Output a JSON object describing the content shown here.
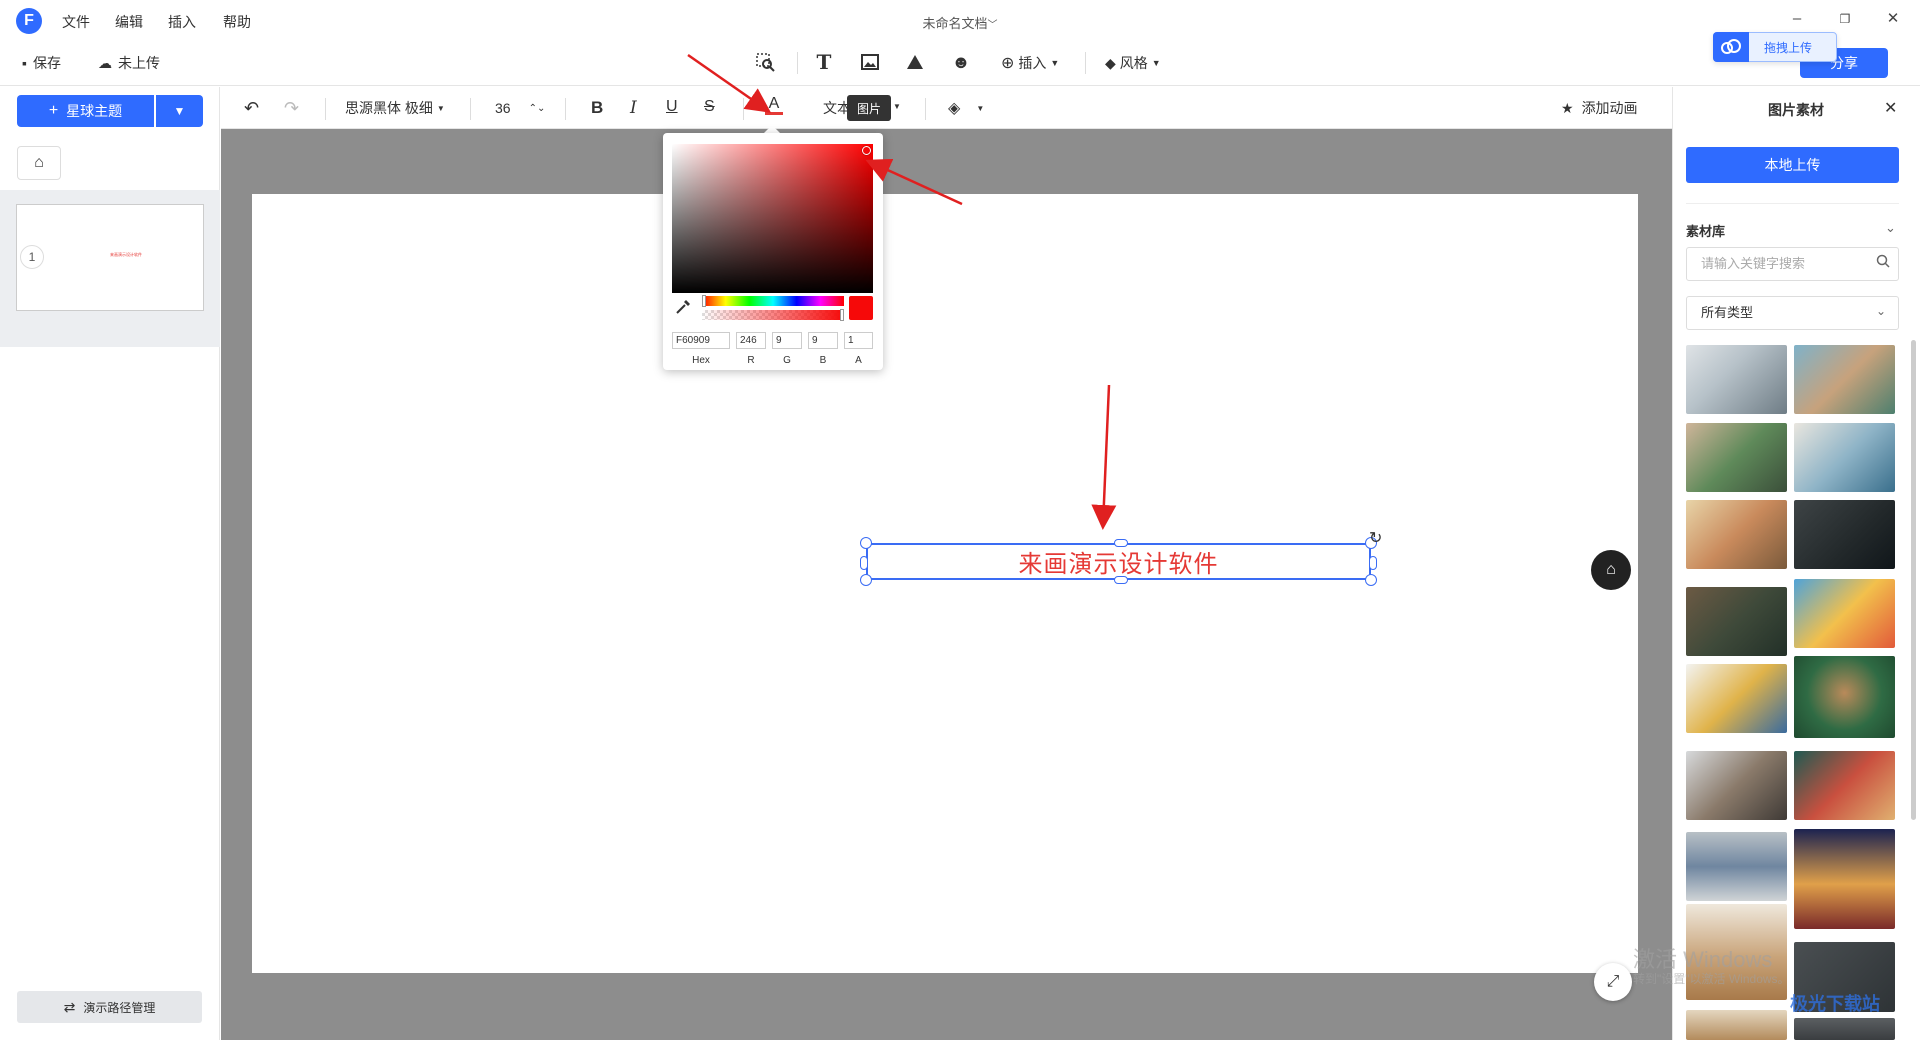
{
  "titlebar": {
    "menus": [
      "文件",
      "编辑",
      "插入",
      "帮助"
    ],
    "doc_title": "未命名文档",
    "doc_title_caret": "﹀",
    "win_controls": [
      "–",
      "❐",
      "✕"
    ]
  },
  "toolbar": {
    "save_label": "保存",
    "upload_state": "未上传",
    "insert_label": "插入",
    "style_label": "风格",
    "share_label": "分享",
    "drag_upload_tip": "拖拽上传"
  },
  "left_panel": {
    "theme_label": "星球主题",
    "slide_number": "1",
    "thumb_text": "来画演示设计软件",
    "path_manage_label": "演示路径管理"
  },
  "format_bar": {
    "font": "思源黑体 极细",
    "font_size": "36",
    "text_label": "文本",
    "tooltip": "图片",
    "animation_label": "添加动画"
  },
  "canvas": {
    "text_content": "来画演示设计软件"
  },
  "color_picker": {
    "hex": "F60909",
    "r": "246",
    "g": "9",
    "b": "9",
    "a": "1",
    "labels": [
      "Hex",
      "R",
      "G",
      "B",
      "A"
    ],
    "current_color": "#f60909"
  },
  "right_panel": {
    "title": "图片素材",
    "local_upload": "本地上传",
    "library_title": "素材库",
    "search_placeholder": "请输入关键字搜索",
    "type_select": "所有类型"
  },
  "watermarks": {
    "windows": "激活 Windows",
    "windows_sub": "转到\"设置\"以激活 Windows。",
    "site": "极光下载站"
  },
  "colors": {
    "accent": "#2f6bff",
    "text_red": "#e53935",
    "canvas_bg": "#8d8d8d"
  }
}
